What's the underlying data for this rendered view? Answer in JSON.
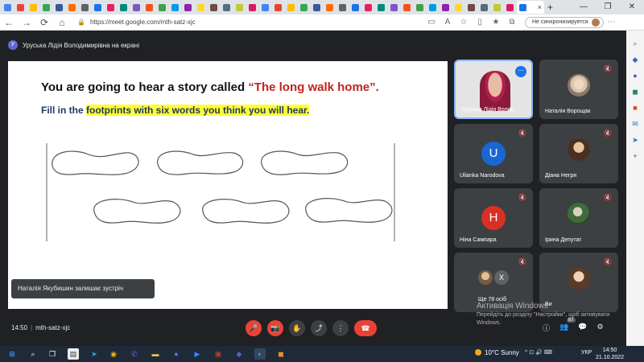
{
  "browser": {
    "url": "https://meet.google.com/mth-satz-xjc",
    "active_tab_close": "×",
    "new_tab": "+",
    "window_controls": [
      "—",
      "❐",
      "✕"
    ],
    "nav": {
      "back": "←",
      "forward": "→",
      "reload": "⟳",
      "home": "⌂"
    },
    "toolbar_icons": [
      "camera-icon",
      "read-aloud-icon",
      "favorite-icon",
      "split-icon",
      "favorites-icon",
      "collections-icon"
    ],
    "sync_label": "Не синхронизируется",
    "sidebar_icons": [
      "search-icon",
      "tag-icon",
      "person-icon",
      "shopping-icon",
      "office-icon",
      "outlook-icon",
      "send-icon",
      "add-icon"
    ]
  },
  "presenter": {
    "initial": "У",
    "label": "Уруська Лідія Володимирівна на екрані"
  },
  "slide": {
    "title_prefix": "You are going to hear a story called ",
    "title_story": "“The long walk home”.",
    "subtitle_prefix": "Fill in the ",
    "subtitle_highlight": "footprints with six words you think you will hear."
  },
  "toast": "Наталія Якубишин залишає зустріч",
  "participants": [
    {
      "name": "Уруська Лідія Волод...",
      "kind": "video",
      "more": "⋯"
    },
    {
      "name": "Наталія Ворощак",
      "kind": "photo",
      "muted": true
    },
    {
      "name": "Ulianka Narodova",
      "kind": "letter",
      "letter": "U",
      "color": "#1967d2",
      "muted": true
    },
    {
      "name": "Діана Негря",
      "kind": "photo",
      "muted": true
    },
    {
      "name": "Ніна Сампара",
      "kind": "letter",
      "letter": "Н",
      "color": "#d93025",
      "muted": true
    },
    {
      "name": "Ірина Депутат",
      "kind": "photo",
      "muted": true
    },
    {
      "name": "Ще 78 осіб",
      "kind": "more",
      "muted": true
    },
    {
      "name": "Ви",
      "kind": "photo",
      "muted": true
    }
  ],
  "more_tile_letter": "X",
  "watermark": {
    "title": "Активація Windows",
    "line1": "Перейдіть до розділу \"Настройки\", щоб активувати",
    "line2": "Windows."
  },
  "meeting": {
    "time": "14:50",
    "separator": "|",
    "code": "mth-satz-xjc",
    "participant_count": "87"
  },
  "controls": {
    "mic": "🎤",
    "camera": "📷",
    "hand": "✋",
    "present": "⤴",
    "more": "⋮",
    "hangup": "☎"
  },
  "right_controls": {
    "info": "ⓘ",
    "people": "👥",
    "chat": "💬",
    "activities": "⚙"
  },
  "taskbar": {
    "weather_temp": "10°C",
    "weather_text": "Sunny",
    "tray": "^ ⊡ 🔊 ⌨",
    "lang": "УКР",
    "time": "14:50",
    "date": "21.10.2022"
  }
}
